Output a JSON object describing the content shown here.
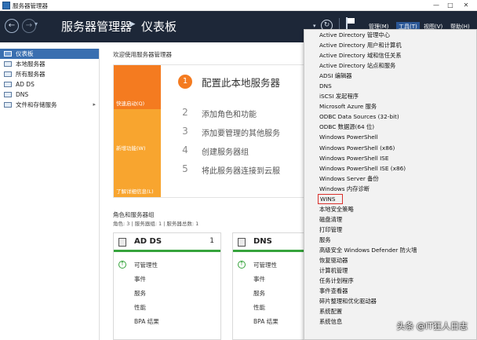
{
  "window": {
    "title": "服务器管理器",
    "minimize": "—",
    "maximize": "□",
    "close": "✕"
  },
  "header": {
    "back_icon": "arrow-left",
    "forward_icon": "arrow-right",
    "breadcrumb_root": "服务器管理器",
    "breadcrumb_sep": "▸",
    "breadcrumb_current": "仪表板",
    "menus": [
      "管理(M)",
      "工具(T)",
      "视图(V)",
      "帮助(H)"
    ],
    "active_menu": "工具(T)"
  },
  "sidebar": {
    "items": [
      {
        "label": "仪表板",
        "icon": "dashboard-icon",
        "active": true
      },
      {
        "label": "本地服务器",
        "icon": "server-icon"
      },
      {
        "label": "所有服务器",
        "icon": "servers-icon"
      },
      {
        "label": "AD DS",
        "icon": "ad-ds-icon"
      },
      {
        "label": "DNS",
        "icon": "dns-icon"
      },
      {
        "label": "文件和存储服务",
        "icon": "storage-icon",
        "has_arrow": true
      }
    ]
  },
  "welcome": {
    "title": "欢迎使用服务器管理器",
    "tiles": [
      "快速启动(Q)",
      "新增功能(W)",
      "了解详细信息(L)"
    ],
    "steps": [
      {
        "num": "1",
        "text": "配置此本地服务器"
      },
      {
        "num": "2",
        "text": "添加角色和功能"
      },
      {
        "num": "3",
        "text": "添加要管理的其他服务"
      },
      {
        "num": "4",
        "text": "创建服务器组"
      },
      {
        "num": "5",
        "text": "将此服务器连接到云服"
      }
    ]
  },
  "roles": {
    "title": "角色和服务器组",
    "subtitle": "角色: 3 | 服务器组: 1 | 服务器总数: 1",
    "cards": [
      {
        "name": "AD DS",
        "count": "1",
        "rows": [
          "可管理性",
          "事件",
          "服务",
          "性能",
          "BPA 结果"
        ]
      },
      {
        "name": "DNS",
        "count": "",
        "rows": [
          "可管理性",
          "事件",
          "服务",
          "性能",
          "BPA 结果"
        ]
      }
    ]
  },
  "tools_menu": {
    "highlighted": "WINS",
    "items": [
      "Active Directory 管理中心",
      "Active Directory 用户和计算机",
      "Active Directory 域和信任关系",
      "Active Directory 站点和服务",
      "ADSI 编辑器",
      "DNS",
      "iSCSI 发起程序",
      "Microsoft Azure 服务",
      "ODBC Data Sources (32-bit)",
      "ODBC 数据源(64 位)",
      "Windows PowerShell",
      "Windows PowerShell (x86)",
      "Windows PowerShell ISE",
      "Windows PowerShell ISE (x86)",
      "Windows Server 备份",
      "Windows 内存诊断",
      "WINS",
      "本地安全策略",
      "磁盘清理",
      "打印管理",
      "服务",
      "高级安全 Windows Defender 防火墙",
      "恢复驱动器",
      "计算机管理",
      "任务计划程序",
      "事件查看器",
      "碎片整理和优化驱动器",
      "系统配置",
      "系统信息"
    ]
  },
  "watermark": "头条 @IT狂人日志"
}
